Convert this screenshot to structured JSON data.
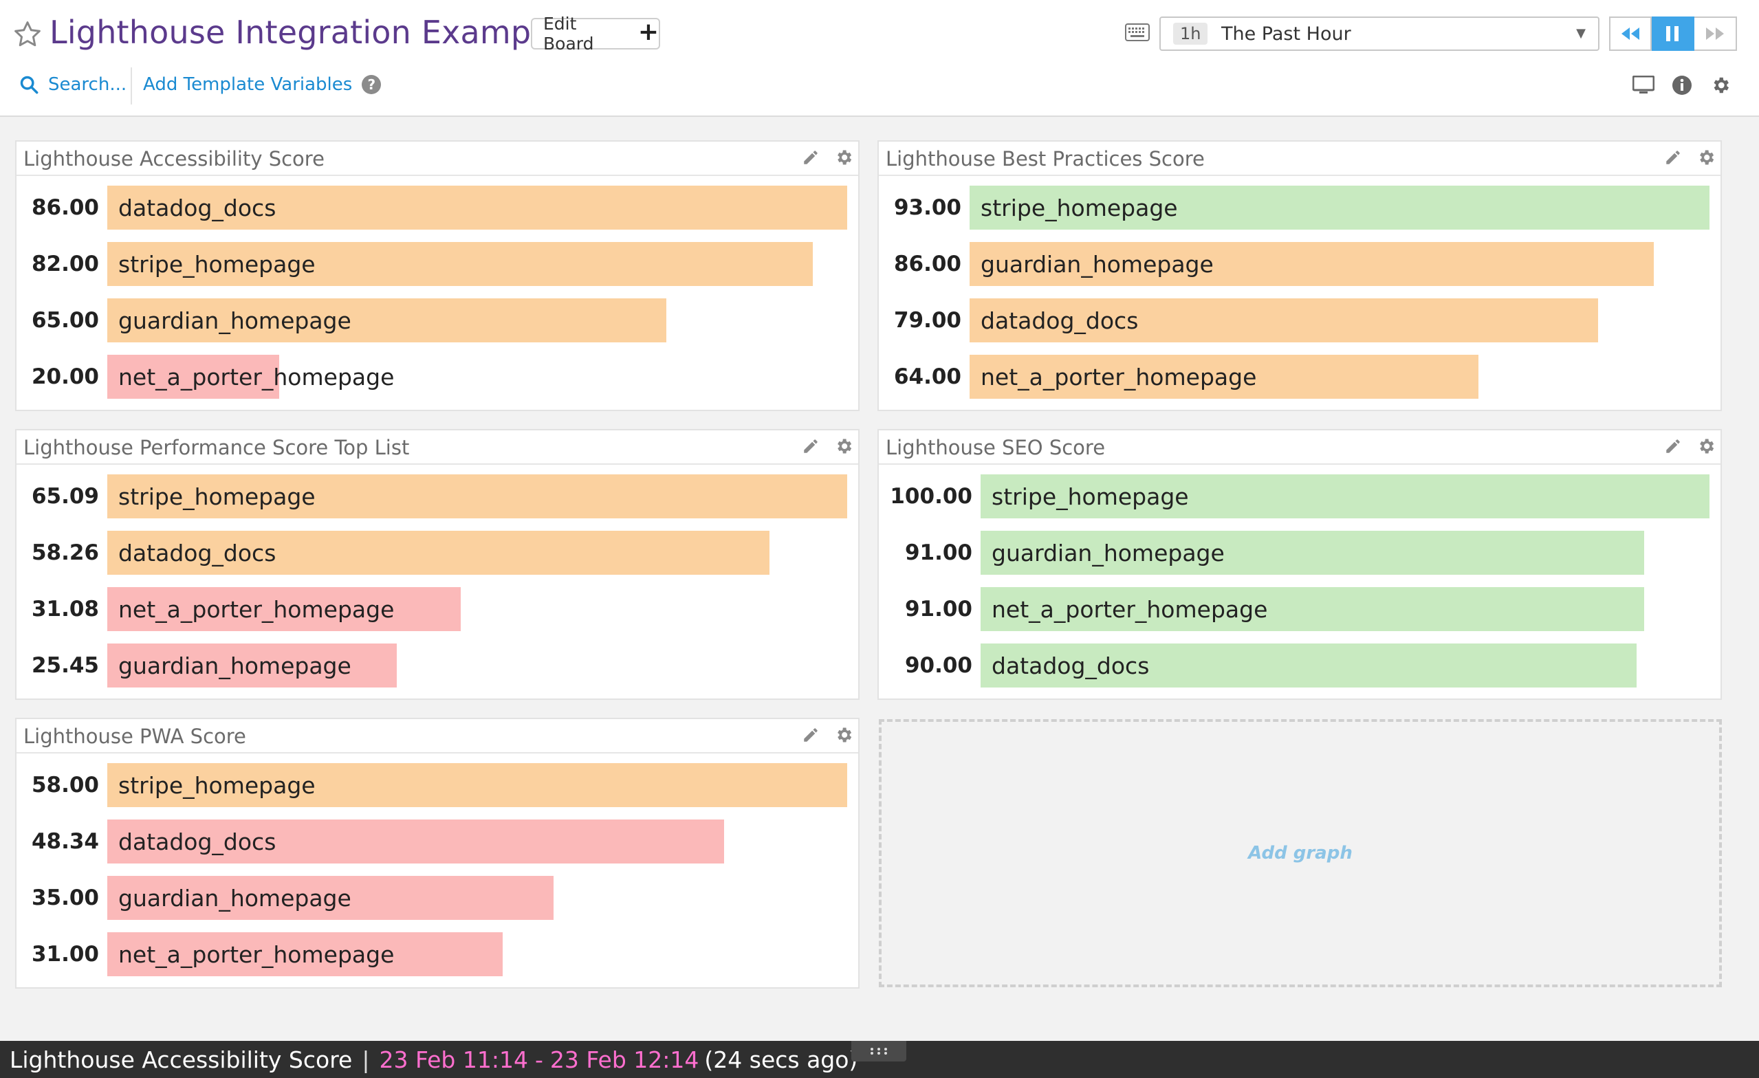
{
  "header": {
    "title": "Lighthouse Integration Example",
    "edit_board_label": "Edit Board",
    "search_label": "Search...",
    "template_vars_label": "Add Template Variables",
    "time_badge": "1h",
    "time_label": "The Past Hour"
  },
  "colors": {
    "title": "#5b3a8c",
    "link": "#1a8ad1",
    "bar_orange": "#fbd19f",
    "bar_green": "#c8eac0",
    "bar_red": "#fbb9b9",
    "accent": "#3fa5e8"
  },
  "widgets": [
    {
      "title": "Lighthouse Accessibility Score",
      "rows": [
        {
          "value": "86.00",
          "label": "datadog_docs",
          "color": "orange"
        },
        {
          "value": "82.00",
          "label": "stripe_homepage",
          "color": "orange"
        },
        {
          "value": "65.00",
          "label": "guardian_homepage",
          "color": "orange"
        },
        {
          "value": "20.00",
          "label": "net_a_porter_homepage",
          "color": "red"
        }
      ]
    },
    {
      "title": "Lighthouse Best Practices Score",
      "rows": [
        {
          "value": "93.00",
          "label": "stripe_homepage",
          "color": "green"
        },
        {
          "value": "86.00",
          "label": "guardian_homepage",
          "color": "orange"
        },
        {
          "value": "79.00",
          "label": "datadog_docs",
          "color": "orange"
        },
        {
          "value": "64.00",
          "label": "net_a_porter_homepage",
          "color": "orange"
        }
      ]
    },
    {
      "title": "Lighthouse Performance Score Top List",
      "rows": [
        {
          "value": "65.09",
          "label": "stripe_homepage",
          "color": "orange"
        },
        {
          "value": "58.26",
          "label": "datadog_docs",
          "color": "orange"
        },
        {
          "value": "31.08",
          "label": "net_a_porter_homepage",
          "color": "red"
        },
        {
          "value": "25.45",
          "label": "guardian_homepage",
          "color": "red"
        }
      ]
    },
    {
      "title": "Lighthouse SEO Score",
      "rows": [
        {
          "value": "100.00",
          "label": "stripe_homepage",
          "color": "green"
        },
        {
          "value": "91.00",
          "label": "guardian_homepage",
          "color": "green"
        },
        {
          "value": "91.00",
          "label": "net_a_porter_homepage",
          "color": "green"
        },
        {
          "value": "90.00",
          "label": "datadog_docs",
          "color": "green"
        }
      ]
    },
    {
      "title": "Lighthouse PWA Score",
      "rows": [
        {
          "value": "58.00",
          "label": "stripe_homepage",
          "color": "orange"
        },
        {
          "value": "48.34",
          "label": "datadog_docs",
          "color": "red"
        },
        {
          "value": "35.00",
          "label": "guardian_homepage",
          "color": "red"
        },
        {
          "value": "31.00",
          "label": "net_a_porter_homepage",
          "color": "red"
        }
      ]
    }
  ],
  "add_graph_label": "Add graph",
  "status": {
    "widget_name": "Lighthouse Accessibility Score",
    "separator": "|",
    "range_start": "23 Feb 11:14",
    "range_dash": "-",
    "range_end": "23 Feb 12:14",
    "relative": "(24 secs ago)"
  }
}
